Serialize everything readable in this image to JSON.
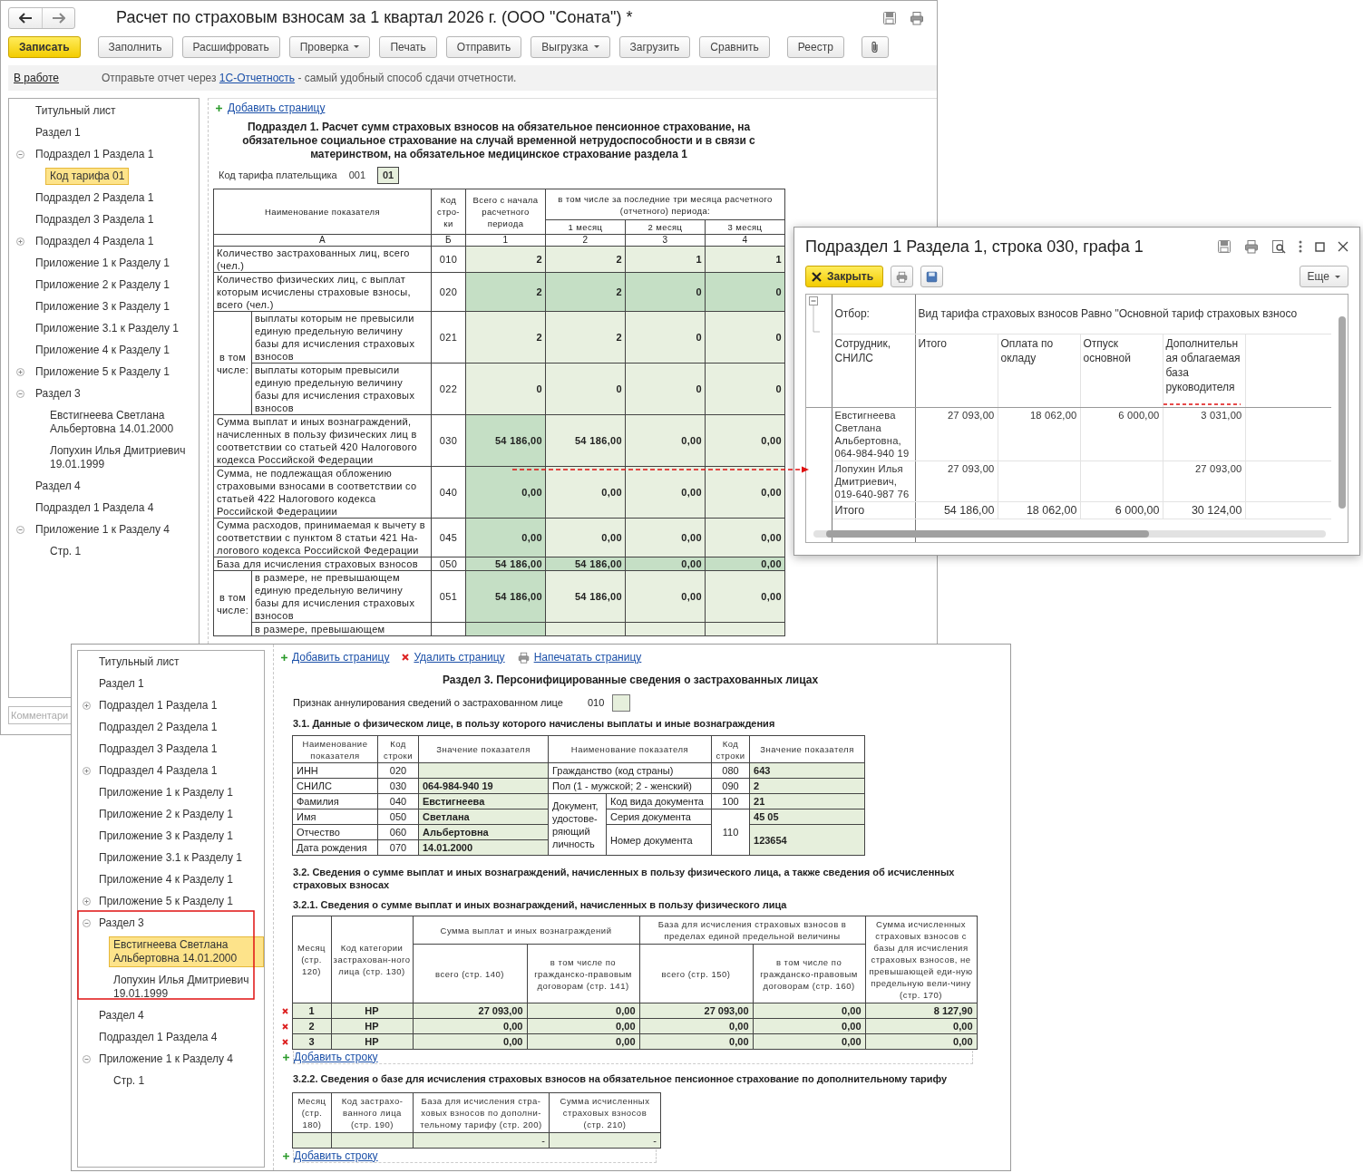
{
  "main_window": {
    "title": "Расчет по страховым взносам за 1 квартал 2026 г. (ООО \"Соната\") *",
    "toolbar": [
      {
        "label": "Записать",
        "kind": "primary"
      },
      {
        "label": "Заполнить",
        "kind": "plain"
      },
      {
        "label": "Расшифровать",
        "kind": "plain"
      },
      {
        "label": "Проверка",
        "kind": "menu"
      },
      {
        "label": "Печать",
        "kind": "plain"
      },
      {
        "label": "Отправить",
        "kind": "plain"
      },
      {
        "label": "Выгрузка",
        "kind": "menu"
      },
      {
        "label": "Загрузить",
        "kind": "plain"
      },
      {
        "label": "Сравнить",
        "kind": "plain"
      },
      {
        "label": "Реестр",
        "kind": "plain"
      },
      {
        "kind": "attach"
      }
    ],
    "status_link": "В работе",
    "notice": {
      "before": "Отправьте отчет через ",
      "link": "1С-Отчетность",
      "after": " - самый удобный способ сдачи отчетности."
    },
    "tree": [
      {
        "label": "Титульный лист",
        "selected": false
      },
      {
        "label": "Раздел 1",
        "selected": false
      },
      {
        "label": "Подраздел 1 Раздела 1",
        "selected": false,
        "expanded": true,
        "children": [
          {
            "label": "Код тарифа 01",
            "selected": true
          }
        ]
      },
      {
        "label": "Подраздел 2 Раздела 1",
        "selected": false
      },
      {
        "label": "Подраздел 3 Раздела 1",
        "selected": false
      },
      {
        "label": "Подраздел 4 Раздела 1",
        "selected": false,
        "expanded": false
      },
      {
        "label": "Приложение 1 к Разделу 1",
        "selected": false
      },
      {
        "label": "Приложение 2 к Разделу 1",
        "selected": false
      },
      {
        "label": "Приложение 3 к Разделу 1",
        "selected": false
      },
      {
        "label": "Приложение 3.1 к Разделу 1",
        "selected": false
      },
      {
        "label": "Приложение 4 к Разделу 1",
        "selected": false
      },
      {
        "label": "Приложение 5 к Разделу 1",
        "selected": false,
        "expanded": false
      },
      {
        "label": "Раздел 3",
        "selected": false,
        "expanded": true,
        "children": [
          {
            "label": "Евстигнеева Светлана Альбертовна 14.01.2000",
            "selected": false
          },
          {
            "label": "Лопухин Илья Дмитриевич 19.01.1999",
            "selected": false
          }
        ]
      },
      {
        "label": "Раздел 4",
        "selected": false
      },
      {
        "label": "Подраздел 1 Раздела 4",
        "selected": false
      },
      {
        "label": "Приложение 1 к Разделу 4",
        "selected": false,
        "expanded": true,
        "children": [
          {
            "label": "Стр. 1",
            "selected": false
          }
        ]
      }
    ],
    "page": {
      "add_link": "Добавить страницу",
      "heading": "Подраздел 1. Расчет сумм страховых взносов на обязательное пенсионное страхование, на обязательное социальное страхование на случай временной нетрудоспособности и в связи с материнством, на обязательное медицинское страхование раздела 1",
      "tariff": {
        "label": "Код тарифа плательщика",
        "code": "001",
        "value": "01"
      },
      "table": {
        "head": {
          "name": "Наименование показателя",
          "code": "Код стро-ки",
          "total": "Всего с начала расчетного периода",
          "months_group": "в том числе за последние три месяца расчетного (отчетного) периода:",
          "months": [
            "1 месяц",
            "2 месяц",
            "3 месяц"
          ]
        },
        "letters": [
          "А",
          "Б",
          "1",
          "2",
          "3",
          "4"
        ],
        "rows": [
          {
            "kind": "row",
            "label": "Количество застрахованных лиц, всего (чел.)",
            "code": "010",
            "values": [
              "2",
              "2",
              "1",
              "1"
            ],
            "shaded": false,
            "total_shaded": false
          },
          {
            "kind": "row",
            "label": "Количество физических лиц, с выплат которым исчислены страховые взносы, всего (чел.)",
            "code": "020",
            "values": [
              "2",
              "2",
              "0",
              "0"
            ],
            "shaded": true
          },
          {
            "kind": "group",
            "label": "в том числе:",
            "rows": [
              {
                "label": "выплаты которым не превысили единую предельную величину базы для исчисления страховых взносов",
                "code": "021",
                "values": [
                  "2",
                  "2",
                  "0",
                  "0"
                ],
                "shaded": false,
                "total_shaded": false
              },
              {
                "label": "выплаты которым превысили единую предельную величину базы для исчисления страховых взносов",
                "code": "022",
                "values": [
                  "0",
                  "0",
                  "0",
                  "0"
                ],
                "shaded": false,
                "total_shaded": false
              }
            ]
          },
          {
            "kind": "row",
            "label": "Сумма выплат и иных вознаграждений, начисленных в пользу физических лиц в соответствии со статьей 420 Налогового кодекса Российской Федерации",
            "code": "030",
            "values": [
              "54 186,00",
              "54 186,00",
              "0,00",
              "0,00"
            ],
            "shaded": false,
            "total_shaded": true
          },
          {
            "kind": "row",
            "label": "Сумма, не подлежащая обложению страховыми взносами в соответствии со статьей 422 Налогового кодекса Российской Федерациии",
            "code": "040",
            "values": [
              "0,00",
              "0,00",
              "0,00",
              "0,00"
            ],
            "shaded": false,
            "total_shaded": true
          },
          {
            "kind": "row",
            "label": "Сумма расходов, принимаемая к вычету в соответствии с пунктом 8 статьи 421 На-логового кодекса Российской Федерации",
            "code": "045",
            "values": [
              "0,00",
              "0,00",
              "0,00",
              "0,00"
            ],
            "shaded": false,
            "total_shaded": true
          },
          {
            "kind": "row",
            "label": "База для исчисления страховых взносов",
            "code": "050",
            "values": [
              "54 186,00",
              "54 186,00",
              "0,00",
              "0,00"
            ],
            "shaded": true
          },
          {
            "kind": "group",
            "label": "в том числе:",
            "rows": [
              {
                "label": "в размере, не превышающем единую предельную величину базы для исчисления страховых взносов",
                "code": "051",
                "values": [
                  "54 186,00",
                  "54 186,00",
                  "0,00",
                  "0,00"
                ],
                "shaded": false,
                "total_shaded": true
              },
              {
                "label": "в размере, превышающем",
                "shaded": false,
                "total_shaded": true
              }
            ]
          }
        ]
      }
    },
    "comment": {
      "placeholder": "Комментари"
    }
  },
  "popup": {
    "title": "Подраздел 1 Раздела 1, строка 030, графа 1",
    "close": "Закрыть",
    "more": "Еще",
    "filter_label": "Отбор:",
    "filter": "Вид тарифа страховых взносов Равно \"Основной тариф страховых взносо",
    "columns": [
      "Сотрудник, СНИЛС",
      "Итого",
      "Оплата по окладу",
      "Отпуск основной",
      "Дополнительная облагаемая база руководителя"
    ],
    "rows": [
      {
        "cells": [
          "Евстигнеева Светлана Альбертовна, 064-984-940 19",
          "27 093,00",
          "18 062,00",
          "6 000,00",
          "3 031,00"
        ]
      },
      {
        "cells": [
          "Лопухин Илья Дмитриевич, 019-640-987 76",
          "27 093,00",
          null,
          null,
          "27 093,00"
        ]
      }
    ],
    "total": [
      "Итого",
      "54 186,00",
      "18 062,00",
      "6 000,00",
      "30 124,00"
    ]
  },
  "section_window": {
    "tree": [
      {
        "label": "Титульный лист",
        "selected": false
      },
      {
        "label": "Раздел 1",
        "selected": false
      },
      {
        "label": "Подраздел 1 Раздела 1",
        "selected": false,
        "expanded": false
      },
      {
        "label": "Подраздел 2 Раздела 1",
        "selected": false
      },
      {
        "label": "Подраздел 3 Раздела 1",
        "selected": false
      },
      {
        "label": "Подраздел 4 Раздела 1",
        "selected": false,
        "expanded": false
      },
      {
        "label": "Приложение 1 к Разделу 1",
        "selected": false
      },
      {
        "label": "Приложение 2 к Разделу 1",
        "selected": false
      },
      {
        "label": "Приложение 3 к Разделу 1",
        "selected": false
      },
      {
        "label": "Приложение 3.1 к Разделу 1",
        "selected": false
      },
      {
        "label": "Приложение 4 к Разделу 1",
        "selected": false
      },
      {
        "label": "Приложение 5 к Разделу 1",
        "selected": false,
        "expanded": false
      },
      {
        "label": "Раздел 3",
        "selected": false,
        "expanded": true,
        "children": [
          {
            "label": "Евстигнеева Светлана Альбертовна 14.01.2000",
            "selected": true
          },
          {
            "label": "Лопухин Илья Дмитриевич 19.01.1999",
            "selected": false
          }
        ]
      },
      {
        "label": "Раздел 4",
        "selected": false
      },
      {
        "label": "Подраздел 1 Раздела 4",
        "selected": false
      },
      {
        "label": "Приложение 1 к Разделу 4",
        "selected": false,
        "expanded": true,
        "children": [
          {
            "label": "Стр. 1",
            "selected": false
          }
        ]
      }
    ],
    "links": [
      {
        "label": "Добавить страницу",
        "kind": "add"
      },
      {
        "label": "Удалить страницу",
        "kind": "delete"
      },
      {
        "label": "Напечатать страницу",
        "kind": "print"
      }
    ],
    "heading": "Раздел 3. Персонифицированные сведения о застрахованных лицах",
    "cancel": {
      "label": "Признак аннулирования сведений о застрахованном лице",
      "code": "010"
    },
    "person": {
      "title": "3.1. Данные о физическом лице, в пользу которого начислены выплаты и иные вознаграждения",
      "headers": [
        "Наименование показателя",
        "Код строки",
        "Значение показателя",
        "Наименование показателя",
        "Код строки",
        "Значение показателя"
      ],
      "left": [
        {
          "label": "ИНН",
          "code": "020"
        },
        {
          "label": "СНИЛС",
          "code": "030",
          "value": "064-984-940 19"
        },
        {
          "label": "Фамилия",
          "code": "040",
          "value": "Евстигнеева"
        },
        {
          "label": "Имя",
          "code": "050",
          "value": "Светлана"
        },
        {
          "label": "Отчество",
          "code": "060",
          "value": "Альбертовна"
        },
        {
          "label": "Дата рождения",
          "code": "070",
          "value": "14.01.2000"
        }
      ],
      "right": [
        {
          "label": "Гражданство (код страны)",
          "code": "080",
          "value": "643"
        },
        {
          "label": "Пол (1 - мужской; 2 - женский)",
          "code": "090",
          "value": "2"
        }
      ],
      "document": {
        "label": "Документ, удостове-ряющий личность",
        "code": "110",
        "items": [
          {
            "label": "Код вида документа",
            "code": "100",
            "value": "21"
          },
          {
            "label": "Серия документа",
            "value": "45 05"
          },
          {
            "label": "Номер документа",
            "value": "123654"
          }
        ]
      }
    },
    "payments": {
      "title": "3.2. Сведения о сумме выплат и иных вознаграждений, начисленных в пользу физического лица, а также сведения об исчисленных страховых взносах",
      "subtitle": "3.2.1. Сведения о сумме выплат и иных вознаграждений, начисленных в пользу физического лица",
      "head": {
        "month": "Месяц (стр. 120)",
        "category": "Код категории застрахован-ного лица (стр. 130)",
        "group1": "Сумма выплат и иных вознаграждений",
        "group1_sub": [
          "всего (стр. 140)",
          "в том числе по гражданско-правовым договорам (стр. 141)"
        ],
        "group2": "База для исчисления страховых взносов в пределах единой предельной величины",
        "group2_sub": [
          "всего (стр. 150)",
          "в том числе по гражданско-правовым договорам (стр. 160)"
        ],
        "last": "Сумма исчисленных страховых взносов с базы для исчисления страховых взносов, не превышающей еди-ную предельную вели-чину (стр. 170)"
      },
      "rows": [
        {
          "cells": [
            "1",
            "НР",
            "27 093,00",
            "0,00",
            "27 093,00",
            "0,00",
            "8 127,90"
          ]
        },
        {
          "cells": [
            "2",
            "НР",
            "0,00",
            "0,00",
            "0,00",
            "0,00",
            "0,00"
          ]
        },
        {
          "cells": [
            "3",
            "НР",
            "0,00",
            "0,00",
            "0,00",
            "0,00",
            "0,00"
          ]
        }
      ],
      "add_link": "Добавить строку"
    },
    "extra": {
      "title": "3.2.2. Сведения о базе для исчисления страховых взносов на обязательное пенсионное страхование по дополнительному тарифу",
      "headers": [
        "Месяц (стр. 180)",
        "Код застрахо-ванного лица (стр. 190)",
        "База для исчисления стра-ховых взносов по дополни-тельному тарифу (стр. 200)",
        "Сумма исчисленных страховых взносов (стр. 210)"
      ],
      "rows": [
        {
          "cells": [
            null,
            null,
            "-",
            "-"
          ]
        }
      ],
      "add_link": "Добавить строку"
    }
  }
}
